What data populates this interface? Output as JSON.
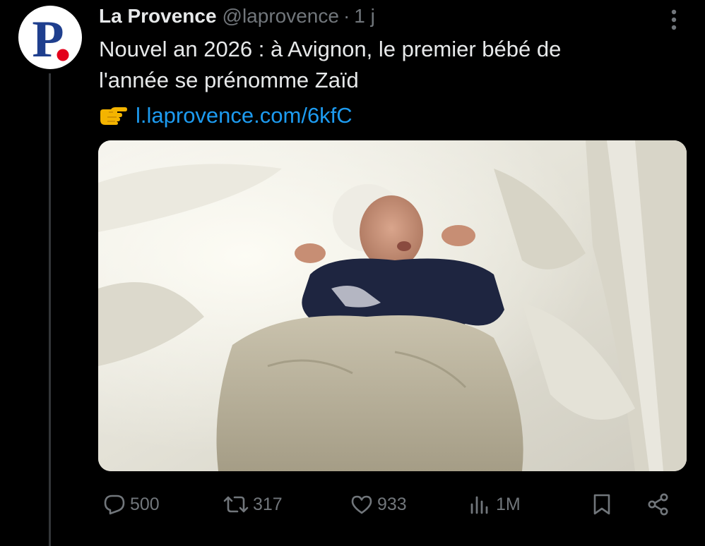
{
  "account": {
    "avatar_letter": "P",
    "name": "La Provence",
    "handle": "@laprovence",
    "separator": "·",
    "time": "1 j"
  },
  "tweet": {
    "line1": "Nouvel an 2026 : à Avignon, le premier bébé de",
    "line2": "l'année se prénomme Zaïd",
    "link_emoji": "pointing-right-hand-icon",
    "link_text": "l.laprovence.com/6kfC",
    "media": "photo-newborn-baby"
  },
  "actions": {
    "replies": "500",
    "reposts": "317",
    "likes": "933",
    "views": "1M"
  },
  "colors": {
    "background": "#000000",
    "text": "#e7e9ea",
    "muted": "#71767b",
    "link": "#1d9bf0",
    "brand_blue": "#1f3f8e",
    "brand_red": "#e3001b"
  }
}
